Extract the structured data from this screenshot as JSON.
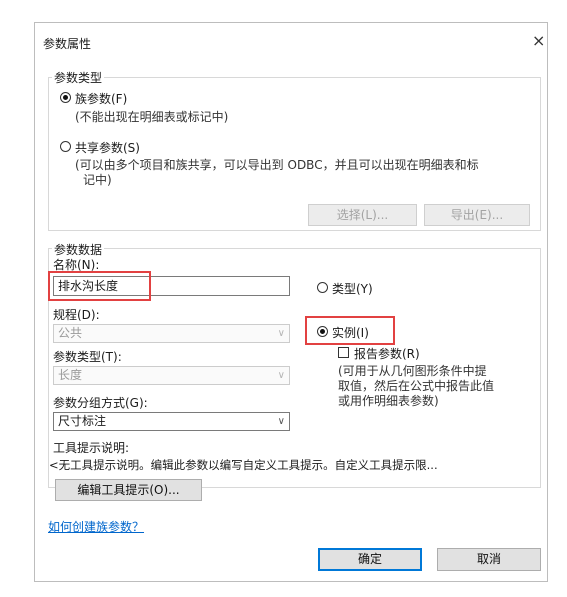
{
  "dialog": {
    "title": "参数属性",
    "close_glyph": "×"
  },
  "param_type": {
    "group_title": "参数类型",
    "family": {
      "label": "族参数(F)",
      "note": "(不能出现在明细表或标记中)",
      "selected": true
    },
    "shared": {
      "label": "共享参数(S)",
      "note_line1": "(可以由多个项目和族共享，可以导出到 ODBC，并且可以出现在明细表和标",
      "note_line2": "记中)",
      "selected": false
    },
    "select_button": "选择(L)...",
    "export_button": "导出(E)..."
  },
  "param_data": {
    "group_title": "参数数据",
    "name_label": "名称(N):",
    "name_value": "排水沟长度",
    "discipline_label": "规程(D):",
    "discipline_value": "公共",
    "type_label": "参数类型(T):",
    "type_value": "长度",
    "group_label": "参数分组方式(G):",
    "group_value": "尺寸标注",
    "type_radio": "类型(Y)",
    "instance_radio": "实例(I)",
    "report_label": "报告参数(R)",
    "report_note_line1": "(可用于从几何图形条件中提",
    "report_note_line2": "取值，然后在公式中报告此值",
    "report_note_line3": "或用作明细表参数)"
  },
  "tooltip": {
    "label": "工具提示说明:",
    "text": "<无工具提示说明。编辑此参数以编写自定义工具提示。自定义工具提示限...",
    "edit_button": "编辑工具提示(O)..."
  },
  "help_link": "如何创建族参数？",
  "footer": {
    "ok": "确定",
    "cancel": "取消"
  },
  "icons": {
    "chevron": "∨"
  },
  "colors": {
    "highlight": "#e24141",
    "link": "#0066cc",
    "default_border": "#0078d7"
  }
}
